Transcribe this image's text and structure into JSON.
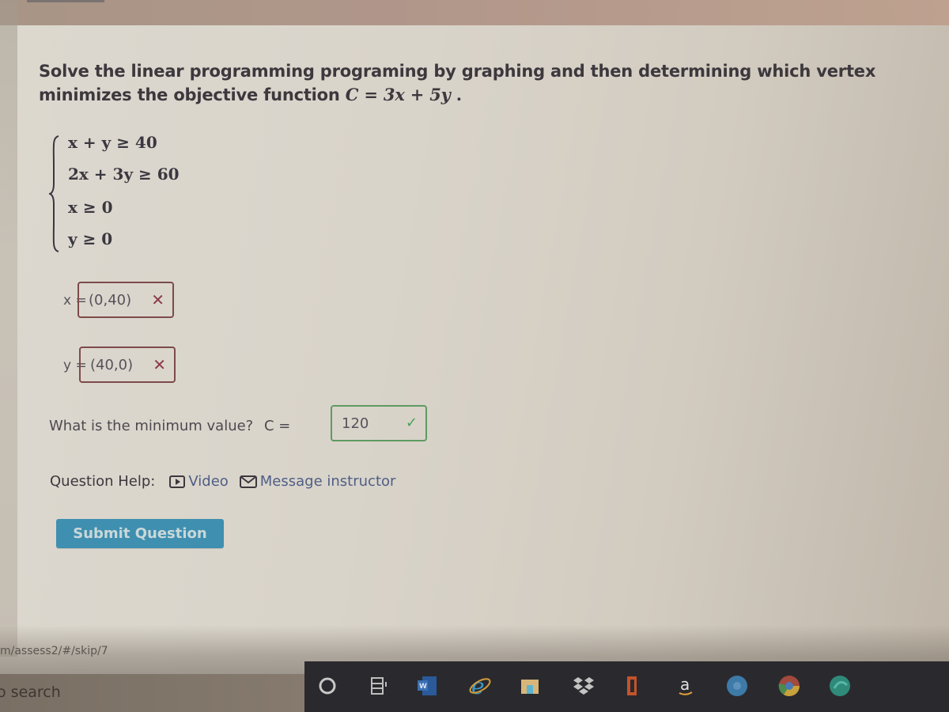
{
  "question": {
    "text_prefix": "Solve the linear programming programing by graphing and then determining which vertex minimizes the objective function ",
    "objective_lhs": "C",
    "objective_eq": " = ",
    "objective_rhs": "3x + 5y",
    "objective_end": " ."
  },
  "constraints": [
    "x + y ≥ 40",
    "2x + 3y ≥ 60",
    "x ≥ 0",
    "y ≥ 0"
  ],
  "answers": {
    "x": {
      "label": "x =",
      "value": "(0,40)",
      "status": "incorrect",
      "mark": "✕"
    },
    "y": {
      "label": "y =",
      "value": "(40,0)",
      "status": "incorrect",
      "mark": "✕"
    },
    "min": {
      "prompt": "What is the minimum value?",
      "label": "C =",
      "value": "120",
      "status": "correct",
      "mark": "✓"
    }
  },
  "help": {
    "label": "Question Help:",
    "video": "Video",
    "message": "Message instructor"
  },
  "submit_label": "Submit Question",
  "status_url": "m/assess2/#/skip/7",
  "taskbar": {
    "search_placeholder": "o search",
    "icons": [
      "cortana-icon",
      "task-view-icon",
      "word-icon",
      "internet-explorer-icon",
      "file-explorer-icon",
      "dropbox-icon",
      "office-icon",
      "amazon-icon",
      "browser-icon",
      "chrome-icon",
      "edge-icon"
    ]
  },
  "colors": {
    "submit_bg": "#3f8fb0",
    "incorrect": "#8b3a4a",
    "correct": "#4aa05a",
    "link": "#4f5e86"
  }
}
